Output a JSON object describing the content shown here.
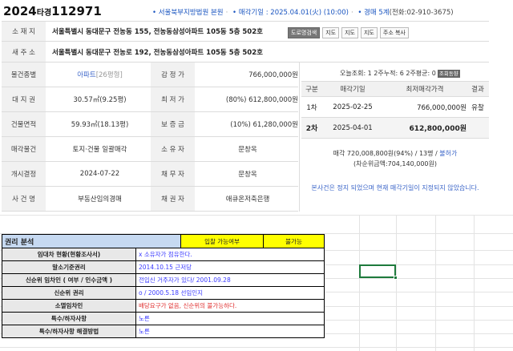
{
  "header": {
    "case_year": "2024",
    "case_type": "타경",
    "case_no": "112971",
    "court": "• 서울북부지방법원 본원",
    "sale_date": "• 매각기일 : 2025.04.01(火) (10:00)",
    "dept": "• 경매 5계",
    "phone": "(전화:02-910-3675)"
  },
  "address": {
    "location_label": "소 재 지",
    "location_value": "서울특별시 동대문구 전농동 155, 전농동삼성아파트 105동 5층 502호",
    "new_label": "새 주 소",
    "new_value": "서울특별시 동대문구 전농로 192, 전농동삼성아파트 105동 5층 502호",
    "map_buttons": [
      "도로명검색",
      "지도",
      "지도",
      "지도",
      "주소 복사"
    ]
  },
  "info_rows": [
    {
      "l1": "물건종별",
      "v1": "아파트",
      "v1b": "[26평형]",
      "l2": "감 정 가",
      "v2": "766,000,000원"
    },
    {
      "l1": "대 지 권",
      "v1": "30.57㎡(9.25평)",
      "l2": "최 저 가",
      "v2": "(80%) 612,800,000원"
    },
    {
      "l1": "건물면적",
      "v1": "59.93㎡(18.13평)",
      "l2": "보 증 금",
      "v2": "(10%) 61,280,000원"
    },
    {
      "l1": "매각물건",
      "v1": "토지·건물 일괄매각",
      "l2": "소 유 자",
      "v2": "문창옥"
    },
    {
      "l1": "개시결정",
      "v1": "2024-07-22",
      "l2": "채 무 자",
      "v2": "문창옥"
    },
    {
      "l1": "사 건 명",
      "v1": "부동산임의경매",
      "l2": "채 권 자",
      "v2": "애큐온저축은행"
    }
  ],
  "views": {
    "text": "오늘조회: 1  2주누적: 6  2주평균: 0",
    "button": "조회동향"
  },
  "price_table": {
    "headers": [
      "구분",
      "매각기일",
      "최저매각가격",
      "결과"
    ],
    "rows": [
      {
        "round": "1차",
        "date": "2025-02-25",
        "price": "766,000,000원",
        "result": "유찰"
      },
      {
        "round": "2차",
        "date": "2025-04-01",
        "price": "612,800,000원",
        "result": ""
      }
    ]
  },
  "summary": {
    "line1": "매각 720,008,800원(94%) / 13명 / ",
    "link": "불허가",
    "line2": "(차순위금액:704,140,000원)"
  },
  "note": "본사건은 정지 되었으며 현재 매각기일이 지정되지 않았습니다.",
  "rights": {
    "title": "권리 분석",
    "col_head1": "입찰 가능여부",
    "col_head2": "불가능",
    "rows": [
      {
        "label": "임대차 현황(현황조사서)",
        "value": "x 소유자가 점유한다.",
        "red": false
      },
      {
        "label": "말소기준권리",
        "value": "2014.10.15 근저당",
        "red": false
      },
      {
        "label": "신순위 임차인 ( 여부 / 인수금액 )",
        "value": "전입신 거주자가 있다/ 2001.09.28",
        "red": false
      },
      {
        "label": "신순위 권리",
        "value": "o / 2000.5.18 선임인지",
        "red": false
      },
      {
        "label": "소멸임차인",
        "value": "배당요구가 없음, 신순위의 불가능하다.",
        "red": true
      },
      {
        "label": "특수/하자사항",
        "value": "노른",
        "red": false
      },
      {
        "label": "특수/하자사항 해결방법",
        "value": "노른",
        "red": false
      }
    ]
  }
}
